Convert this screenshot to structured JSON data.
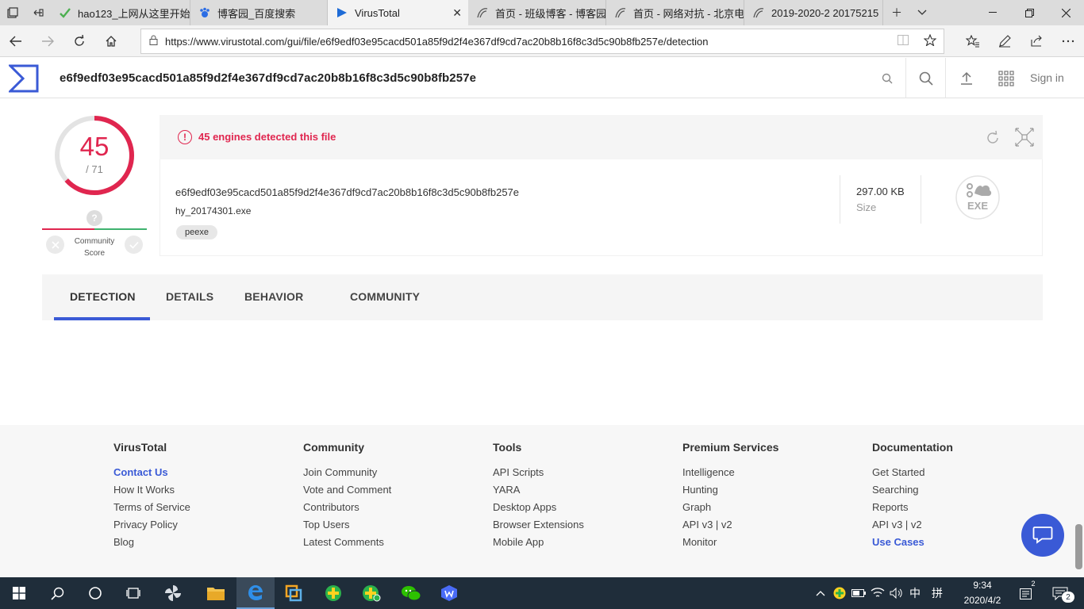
{
  "browser": {
    "tabs": [
      {
        "title": "hao123_上网从这里开始",
        "favicon": "hao123-icon",
        "active": false
      },
      {
        "title": "博客园_百度搜索",
        "favicon": "baidu-paw-icon",
        "active": false
      },
      {
        "title": "VirusTotal",
        "favicon": "virustotal-icon",
        "active": true
      },
      {
        "title": "首页 - 班级博客 - 博客园",
        "favicon": "cnblogs-icon",
        "active": false
      },
      {
        "title": "首页 - 网络对抗 - 北京电子科技学院",
        "favicon": "cnblogs-icon",
        "active": false
      },
      {
        "title": "2019-2020-2 20175215",
        "favicon": "cnblogs-icon",
        "active": false
      }
    ],
    "url": "https://www.virustotal.com/gui/file/e6f9edf03e95cacd501a85f9d2f4e367df9cd7ac20b8b16f8c3d5c90b8fb257e/detection"
  },
  "header": {
    "hash": "e6f9edf03e95cacd501a85f9d2f4e367df9cd7ac20b8b16f8c3d5c90b8fb257e",
    "signin": "Sign in"
  },
  "score": {
    "detections": "45",
    "total": "/ 71",
    "detection_ratio": 0.634,
    "community_label_line1": "Community",
    "community_label_line2": "Score",
    "community_unknown": "?"
  },
  "file": {
    "alert": "45 engines detected this file",
    "hash": "e6f9edf03e95cacd501a85f9d2f4e367df9cd7ac20b8b16f8c3d5c90b8fb257e",
    "name": "hy_20174301.exe",
    "tag": "peexe",
    "size_value": "297.00 KB",
    "size_label": "Size",
    "type_badge": "EXE"
  },
  "tabs": [
    {
      "label": "DETECTION",
      "active": true
    },
    {
      "label": "DETAILS",
      "active": false
    },
    {
      "label": "BEHAVIOR",
      "active": false
    },
    {
      "label": "COMMUNITY",
      "active": false
    }
  ],
  "footer": {
    "columns": [
      {
        "title": "VirusTotal",
        "links": [
          {
            "label": "Contact Us",
            "highlight": true
          },
          {
            "label": "How It Works"
          },
          {
            "label": "Terms of Service"
          },
          {
            "label": "Privacy Policy"
          },
          {
            "label": "Blog"
          }
        ]
      },
      {
        "title": "Community",
        "links": [
          {
            "label": "Join Community"
          },
          {
            "label": "Vote and Comment"
          },
          {
            "label": "Contributors"
          },
          {
            "label": "Top Users"
          },
          {
            "label": "Latest Comments"
          }
        ]
      },
      {
        "title": "Tools",
        "links": [
          {
            "label": "API Scripts"
          },
          {
            "label": "YARA"
          },
          {
            "label": "Desktop Apps"
          },
          {
            "label": "Browser Extensions"
          },
          {
            "label": "Mobile App"
          }
        ]
      },
      {
        "title": "Premium Services",
        "links": [
          {
            "label": "Intelligence"
          },
          {
            "label": "Hunting"
          },
          {
            "label": "Graph"
          },
          {
            "label": "API v3 | v2"
          },
          {
            "label": "Monitor"
          }
        ]
      },
      {
        "title": "Documentation",
        "links": [
          {
            "label": "Get Started"
          },
          {
            "label": "Searching"
          },
          {
            "label": "Reports"
          },
          {
            "label": "API v3 | v2"
          },
          {
            "label": "Use Cases",
            "highlight": true
          }
        ]
      }
    ]
  },
  "taskbar": {
    "time": "9:34",
    "date": "2020/4/2",
    "ime": "中",
    "ime_mode": "拼",
    "notifications": "2"
  },
  "colors": {
    "accent": "#3a5ad6",
    "danger": "#e0264f",
    "ok": "#3fb26f"
  }
}
